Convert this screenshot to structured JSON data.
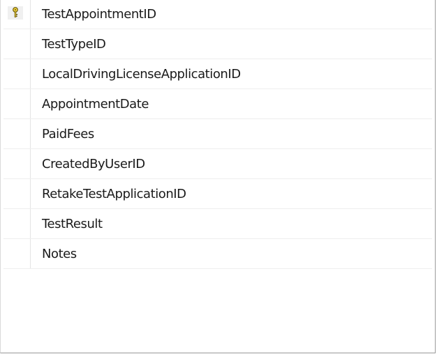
{
  "table": {
    "primary_key_icon": "key-icon",
    "columns": [
      {
        "name": "TestAppointmentID",
        "primary_key": true
      },
      {
        "name": "TestTypeID",
        "primary_key": false
      },
      {
        "name": "LocalDrivingLicenseApplicationID",
        "primary_key": false
      },
      {
        "name": "AppointmentDate",
        "primary_key": false
      },
      {
        "name": "PaidFees",
        "primary_key": false
      },
      {
        "name": "CreatedByUserID",
        "primary_key": false
      },
      {
        "name": "RetakeTestApplicationID",
        "primary_key": false
      },
      {
        "name": "TestResult",
        "primary_key": false
      },
      {
        "name": "Notes",
        "primary_key": false
      }
    ]
  },
  "colors": {
    "key_fill": "#f2d43a",
    "key_stroke": "#6b5a10",
    "text": "#1a1a1a",
    "grid": "#eeeeee"
  }
}
